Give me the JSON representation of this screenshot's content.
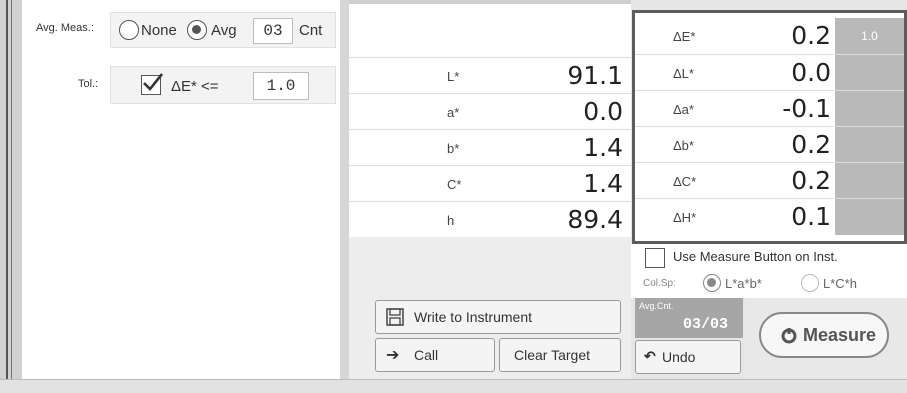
{
  "avg": {
    "label": "Avg. Meas.:",
    "none_label": "None",
    "avg_label": "Avg",
    "count_value": "03",
    "count_unit": "Cnt"
  },
  "tolerance": {
    "label": "Tol.:",
    "condition": "ΔE* <=",
    "value": "1.0"
  },
  "measurements": [
    {
      "name": "L*",
      "value": "91.1"
    },
    {
      "name": "a*",
      "value": "0.0"
    },
    {
      "name": "b*",
      "value": "1.4"
    },
    {
      "name": "C*",
      "value": "1.4"
    },
    {
      "name": "h",
      "value": "89.4"
    }
  ],
  "differences": [
    {
      "name": "ΔE*",
      "value": "0.2",
      "tol": "1.0"
    },
    {
      "name": "ΔL*",
      "value": "0.0",
      "tol": ""
    },
    {
      "name": "Δa*",
      "value": "-0.1",
      "tol": ""
    },
    {
      "name": "Δb*",
      "value": "0.2",
      "tol": ""
    },
    {
      "name": "ΔC*",
      "value": "0.2",
      "tol": ""
    },
    {
      "name": "ΔH*",
      "value": "0.1",
      "tol": ""
    }
  ],
  "buttons": {
    "write": "Write to Instrument",
    "call": "Call",
    "clear": "Clear Target",
    "undo": "Undo",
    "measure": "Measure"
  },
  "options": {
    "use_measure_button": "Use Measure Button on Inst.",
    "colorspace_label": "Col.Sp:",
    "lab": "L*a*b*",
    "lch": "L*C*h"
  },
  "avg_count": {
    "label": "Avg.Cnt.",
    "value": "03/03"
  },
  "colors": {
    "tol_cell": "#b9b9b9",
    "frame": "#5c5c5c"
  }
}
